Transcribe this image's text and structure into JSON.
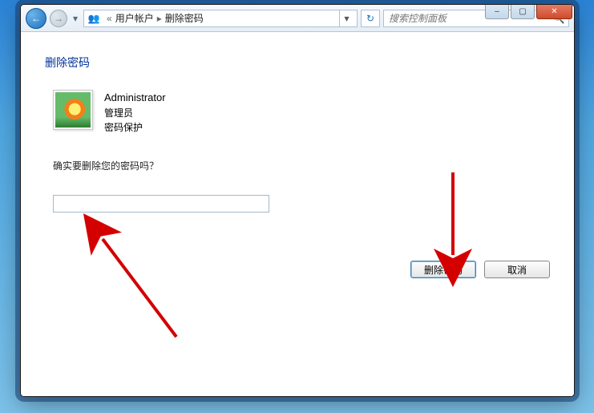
{
  "window_controls": {
    "minimize": "–",
    "maximize": "▢",
    "close": "✕"
  },
  "nav": {
    "back_glyph": "←",
    "forward_glyph": "→",
    "history_glyph": "▾"
  },
  "breadcrumb": {
    "icon_glyph": "👥",
    "part1": "用户帐户",
    "sep": "▸",
    "part2": "删除密码",
    "dropdown_glyph": "▾"
  },
  "refresh_glyph": "↻",
  "search": {
    "placeholder": "搜索控制面板",
    "icon_glyph": "🔍"
  },
  "page": {
    "title": "删除密码",
    "user": {
      "name": "Administrator",
      "role": "管理员",
      "status": "密码保护"
    },
    "prompt": "确实要删除您的密码吗？",
    "password_value": ""
  },
  "buttons": {
    "submit": "删除密码",
    "cancel": "取消"
  }
}
